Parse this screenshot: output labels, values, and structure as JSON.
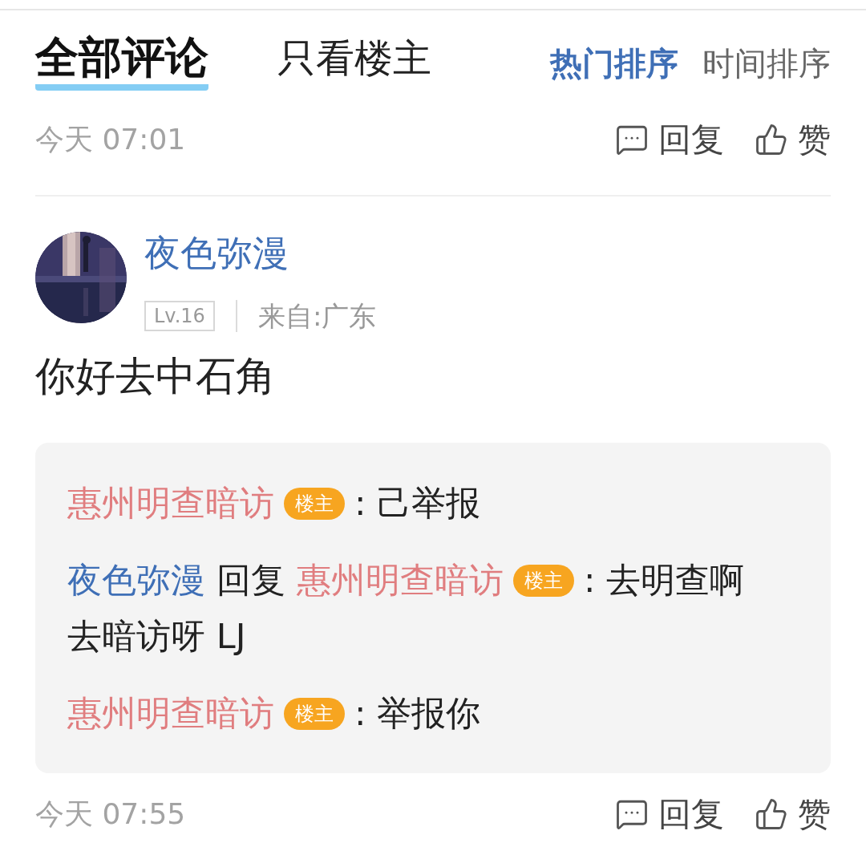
{
  "tabs": [
    {
      "label": "全部评论",
      "selected": true
    },
    {
      "label": "只看楼主",
      "selected": false
    }
  ],
  "sort_options": [
    {
      "label": "热门排序",
      "selected": true
    },
    {
      "label": "时间排序",
      "selected": false
    }
  ],
  "top_actions": {
    "time": "今天 07:01",
    "buttons": [
      {
        "kind": "reply",
        "label": "回复"
      },
      {
        "kind": "like",
        "label": "赞"
      }
    ]
  },
  "comment": {
    "author": "夜色弥漫",
    "level": "Lv.16",
    "location": "来自:广东",
    "text": "你好去中石角",
    "replies": [
      {
        "author": "惠州明查暗访",
        "author_badge": "楼主",
        "text": ": 己举报"
      },
      {
        "author": "夜色弥漫",
        "verb": "回复",
        "target": "惠州明查暗访",
        "target_badge": "楼主",
        "text": ": 去明查啊去暗访呀 LJ"
      },
      {
        "author": "惠州明查暗访",
        "author_badge": "楼主",
        "text": ": 举报你"
      }
    ],
    "time": "今天 07:55",
    "buttons": [
      {
        "kind": "reply",
        "label": "回复"
      },
      {
        "kind": "like",
        "label": "赞"
      }
    ]
  }
}
